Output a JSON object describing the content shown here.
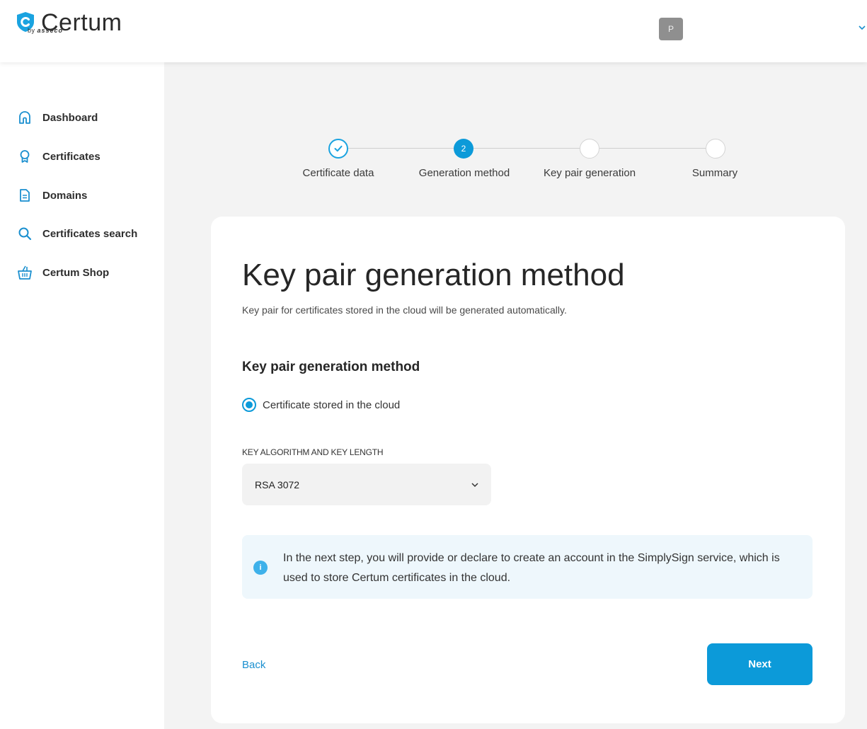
{
  "header": {
    "brand": "Certum",
    "brand_sub_prefix": "by",
    "brand_sub": "asseco",
    "avatar_initial": "P"
  },
  "sidebar": {
    "items": [
      {
        "label": "Dashboard",
        "icon": "home-icon"
      },
      {
        "label": "Certificates",
        "icon": "certificate-icon"
      },
      {
        "label": "Domains",
        "icon": "document-icon"
      },
      {
        "label": "Certificates search",
        "icon": "search-icon"
      },
      {
        "label": "Certum Shop",
        "icon": "basket-icon"
      }
    ]
  },
  "stepper": {
    "steps": [
      {
        "label": "Certificate data",
        "state": "completed"
      },
      {
        "label": "Generation method",
        "state": "active",
        "number": "2"
      },
      {
        "label": "Key pair generation",
        "state": "pending"
      },
      {
        "label": "Summary",
        "state": "pending"
      }
    ]
  },
  "form": {
    "title": "Key pair generation method",
    "subtitle": "Key pair for certificates stored in the cloud will be generated automatically.",
    "section_title": "Key pair generation method",
    "radio_option": "Certificate stored in the cloud",
    "radio_selected": true,
    "key_label": "KEY ALGORITHM AND KEY LENGTH",
    "key_value": "RSA 3072",
    "info_text": "In the next step, you will provide or declare to create an account in the SimplySign service, which is used to store Certum certificates in the cloud.",
    "back_label": "Back",
    "next_label": "Next"
  },
  "colors": {
    "accent": "#0c9ad9",
    "info_bg": "#eef7fc",
    "page_bg": "#f3f3f3"
  }
}
